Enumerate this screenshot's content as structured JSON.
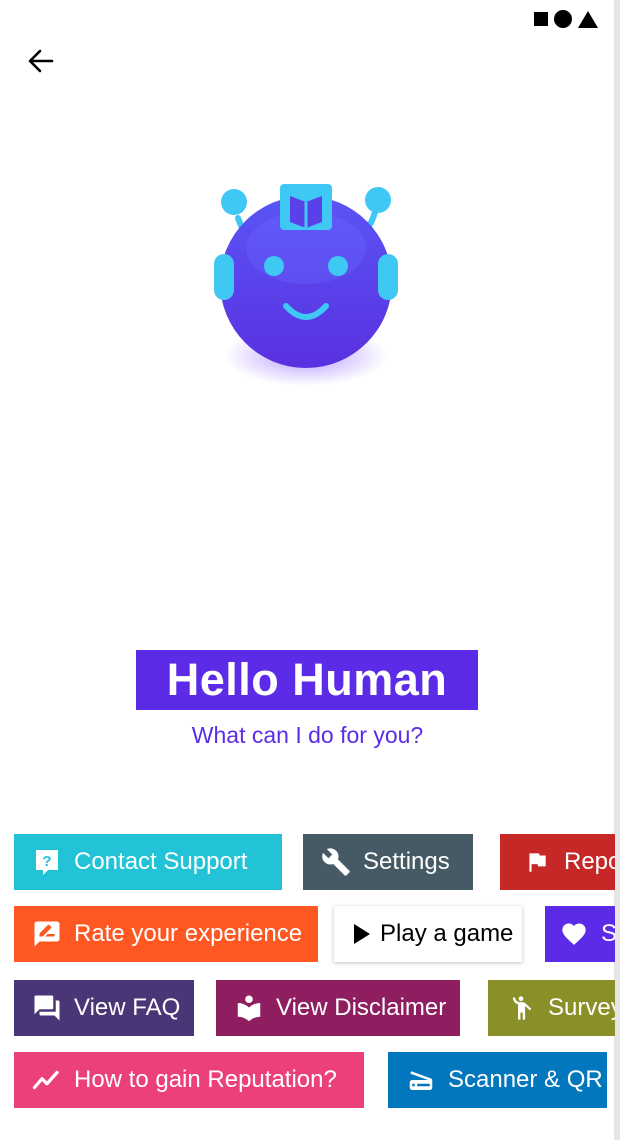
{
  "header": {
    "back_icon": "arrow-left-icon",
    "status_icons": [
      "square-icon",
      "circle-icon",
      "triangle-icon"
    ]
  },
  "hero": {
    "robot_icon": "robot-mascot",
    "title": "Hello Human",
    "subtitle": "What can I do for you?"
  },
  "colors": {
    "accent": "#5b2be8",
    "robot_body": "#5a3cf0",
    "robot_accent": "#40c8f5"
  },
  "actions": [
    {
      "label": "Contact Support",
      "icon": "help-icon",
      "color": "#22c3d6"
    },
    {
      "label": "Settings",
      "icon": "wrench-icon",
      "color": "#455a64"
    },
    {
      "label": "Repo",
      "icon": "flag-icon",
      "color": "#c62828"
    },
    {
      "label": "Rate your experience",
      "icon": "rate-icon",
      "color": "#ff5722"
    },
    {
      "label": "Play a game",
      "icon": "play-icon",
      "color": "#ffffff"
    },
    {
      "label": "S",
      "icon": "heart-icon",
      "color": "#5b2be8"
    },
    {
      "label": "View FAQ",
      "icon": "forum-icon",
      "color": "#4a3577"
    },
    {
      "label": "View Disclaimer",
      "icon": "book-icon",
      "color": "#8e1e60"
    },
    {
      "label": "Survey",
      "icon": "person-icon",
      "color": "#8a8f27"
    },
    {
      "label": "How to gain Reputation?",
      "icon": "trending-up-icon",
      "color": "#ec407a"
    },
    {
      "label": "Scanner & QR",
      "icon": "scanner-icon",
      "color": "#0277bd"
    }
  ]
}
